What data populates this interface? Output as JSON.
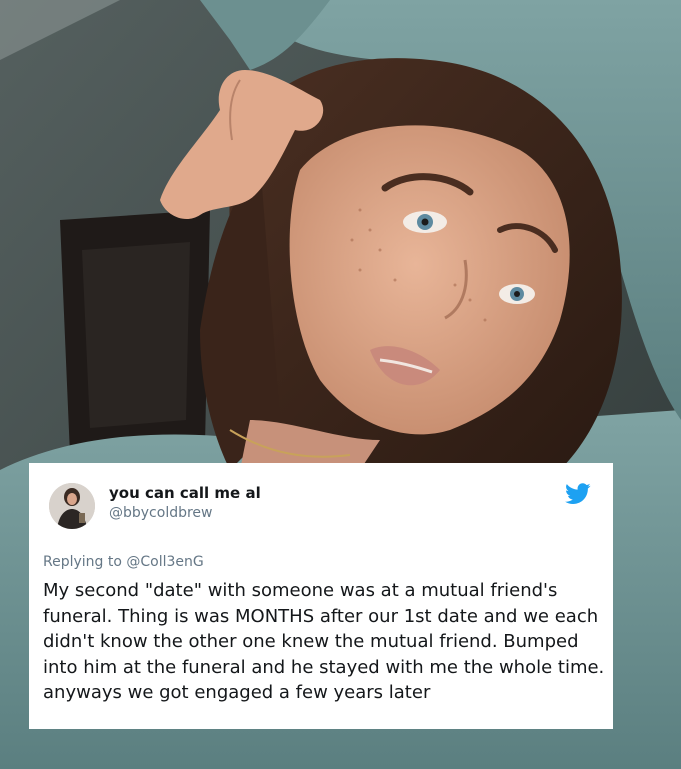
{
  "tweet": {
    "display_name": "you can call me al",
    "handle": "@bbycoldbrew",
    "replying_prefix": "Replying to",
    "replying_to": "@Coll3enG",
    "text": "My second \"date\" with someone was at a mutual friend's funeral. Thing is was MONTHS after our 1st date and we each didn't know the other one knew the mutual friend. Bumped into him at the funeral and he stayed with me the whole time. anyways we got engaged a few years later"
  },
  "icons": {
    "brand": "twitter-bird-icon"
  },
  "colors": {
    "twitter_blue": "#1DA1F2",
    "name_text": "#14171a",
    "secondary_text": "#657786",
    "sweater": "#6f9394",
    "wall": "#4a5656"
  }
}
